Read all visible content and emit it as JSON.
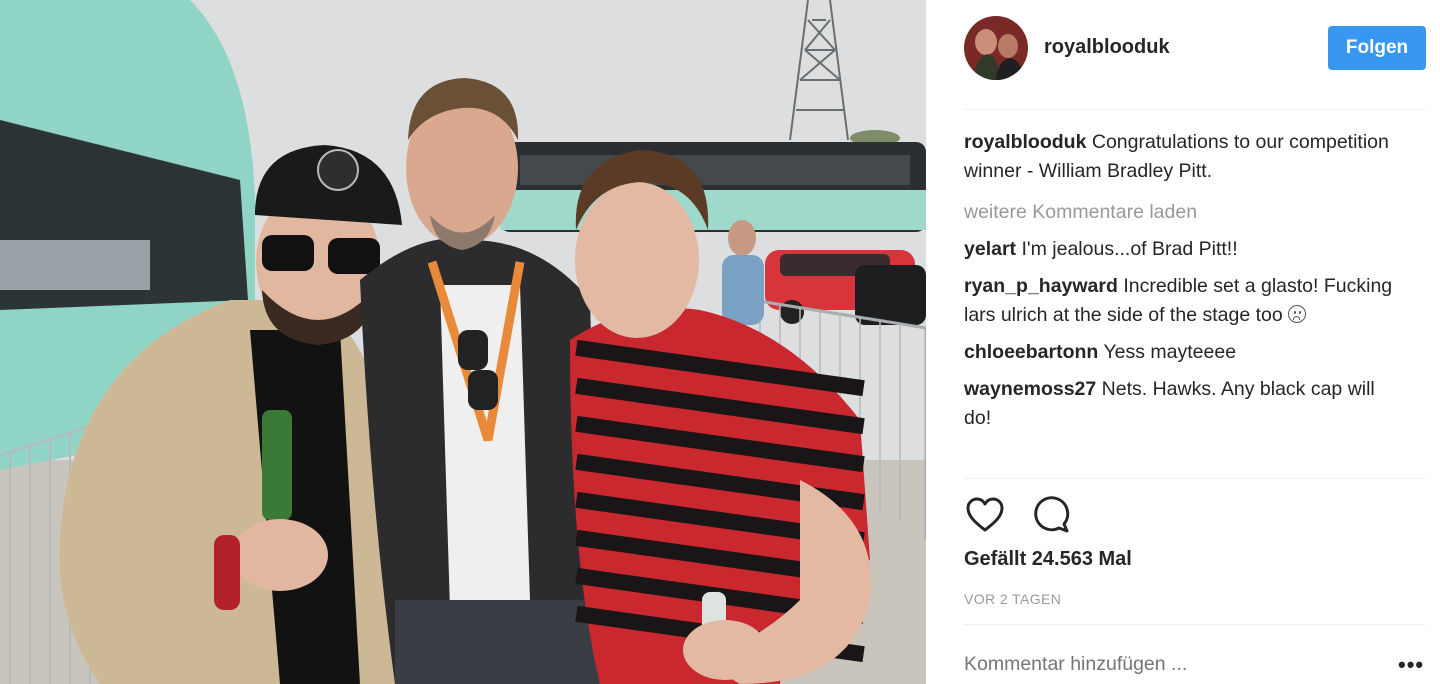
{
  "header": {
    "username": "royalblooduk",
    "follow_label": "Folgen"
  },
  "caption": {
    "user": "royalblooduk",
    "text": "Congratulations to our competition winner - William Bradley Pitt."
  },
  "load_more_label": "weitere Kommentare laden",
  "comments": [
    {
      "user": "yelart",
      "text": "I'm jealous...of Brad Pitt!!"
    },
    {
      "user": "ryan_p_hayward",
      "text": "Incredible set a glasto! Fucking lars ulrich at the side of the stage too"
    },
    {
      "user": "chloeebartonn",
      "text": "Yess mayteeee"
    },
    {
      "user": "waynemoss27",
      "text": "Nets. Hawks. Any black cap will do!"
    }
  ],
  "icons": {
    "like": "heart-icon",
    "comment": "comment-bubble-icon",
    "emoji": "sad-face-icon",
    "options": "more-options-icon"
  },
  "likes_text": "Gefällt 24.563 Mal",
  "timestamp": "VOR 2 TAGEN",
  "comment_input": {
    "placeholder": "Kommentar hinzufügen ..."
  },
  "more_options_label": "•••",
  "colors": {
    "accent": "#3897f0",
    "muted": "#999999",
    "text": "#262626"
  }
}
